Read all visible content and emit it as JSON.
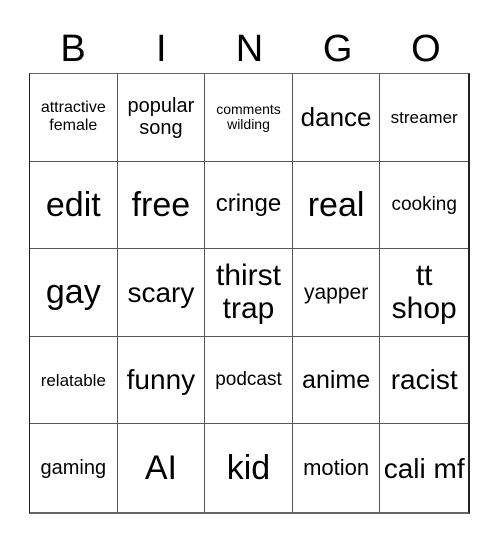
{
  "header": {
    "letters": [
      "B",
      "I",
      "N",
      "G",
      "O"
    ]
  },
  "grid": {
    "rows": [
      [
        {
          "text": "attractive female",
          "size": "s16"
        },
        {
          "text": "popular song",
          "size": "s20"
        },
        {
          "text": "comments wilding",
          "size": "s14"
        },
        {
          "text": "dance",
          "size": "s26"
        },
        {
          "text": "streamer",
          "size": "s17"
        }
      ],
      [
        {
          "text": "edit",
          "size": "s34"
        },
        {
          "text": "free",
          "size": "s34"
        },
        {
          "text": "cringe",
          "size": "s24"
        },
        {
          "text": "real",
          "size": "s34"
        },
        {
          "text": "cooking",
          "size": "s19"
        }
      ],
      [
        {
          "text": "gay",
          "size": "s34"
        },
        {
          "text": "scary",
          "size": "s28"
        },
        {
          "text": "thirst trap",
          "size": "s30"
        },
        {
          "text": "yapper",
          "size": "s21"
        },
        {
          "text": "tt shop",
          "size": "s30"
        }
      ],
      [
        {
          "text": "relatable",
          "size": "s17"
        },
        {
          "text": "funny",
          "size": "s28"
        },
        {
          "text": "podcast",
          "size": "s19"
        },
        {
          "text": "anime",
          "size": "s25"
        },
        {
          "text": "racist",
          "size": "s28"
        }
      ],
      [
        {
          "text": "gaming",
          "size": "s20"
        },
        {
          "text": "AI",
          "size": "s34"
        },
        {
          "text": "kid",
          "size": "s34"
        },
        {
          "text": "motion",
          "size": "s22"
        },
        {
          "text": "cali mf",
          "size": "s28"
        }
      ]
    ]
  }
}
